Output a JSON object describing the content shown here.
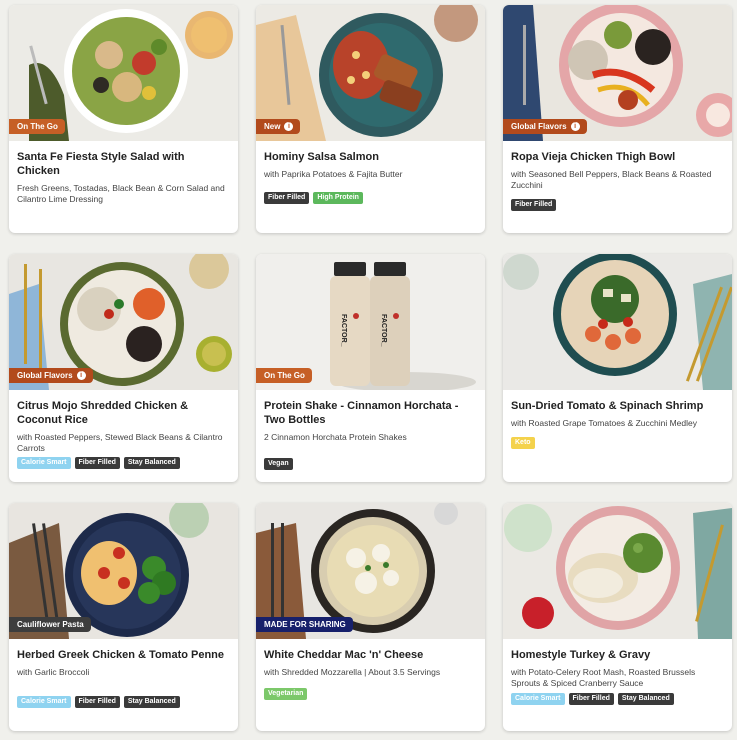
{
  "colors": {
    "tag_orange": "#c65f26",
    "tag_darkorange": "#b24a1c",
    "tag_dark": "#3d3d3d",
    "tag_navy": "#17206b",
    "badge_dark": "#3a3a3a",
    "badge_green": "#5cb85c",
    "badge_blue": "#8fd3f0",
    "badge_yellow": "#f4d24c"
  },
  "cards": [
    {
      "tag": "On The Go",
      "title": "Santa Fe Fiesta Style Salad with Chicken",
      "subtitle": "Fresh Greens, Tostadas, Black Bean & Corn Salad and Cilantro Lime Dressing",
      "badges": []
    },
    {
      "tag": "New",
      "title": "Hominy Salsa Salmon",
      "subtitle": "with Paprika Potatoes & Fajita Butter",
      "badges": [
        "Fiber Filled",
        "High Protein"
      ]
    },
    {
      "tag": "Global Flavors",
      "title": "Ropa Vieja Chicken Thigh Bowl",
      "subtitle": "with Seasoned Bell Peppers, Black Beans & Roasted Zucchini",
      "badges": [
        "Fiber Filled"
      ]
    },
    {
      "tag": "Global Flavors",
      "title": "Citrus Mojo Shredded Chicken & Coconut Rice",
      "subtitle": "with Roasted Peppers, Stewed Black Beans & Cilantro Carrots",
      "badges": [
        "Calorie Smart",
        "Fiber Filled",
        "Stay Balanced"
      ]
    },
    {
      "tag": "On The Go",
      "title": "Protein Shake - Cinnamon Horchata - Two Bottles",
      "subtitle": "2 Cinnamon Horchata Protein Shakes",
      "badges": [
        "Vegan"
      ]
    },
    {
      "tag": "",
      "title": "Sun-Dried Tomato & Spinach Shrimp",
      "subtitle": "with Roasted Grape Tomatoes & Zucchini Medley",
      "badges": [
        "Keto"
      ]
    },
    {
      "tag": "Cauliflower Pasta",
      "title": "Herbed Greek Chicken & Tomato Penne",
      "subtitle": "with Garlic Broccoli",
      "badges": [
        "Calorie Smart",
        "Fiber Filled",
        "Stay Balanced"
      ]
    },
    {
      "tag": "MADE FOR SHARING",
      "title": "White Cheddar Mac 'n' Cheese",
      "subtitle": "with Shredded Mozzarella | About 3.5 Servings",
      "badges": [
        "Vegetarian"
      ]
    },
    {
      "tag": "",
      "title": "Homestyle Turkey & Gravy",
      "subtitle": "with Potato-Celery Root Mash, Roasted Brussels Sprouts & Spiced Cranberry Sauce",
      "badges": [
        "Calorie Smart",
        "Fiber Filled",
        "Stay Balanced"
      ]
    }
  ],
  "bottle_label": "FACTOR_"
}
